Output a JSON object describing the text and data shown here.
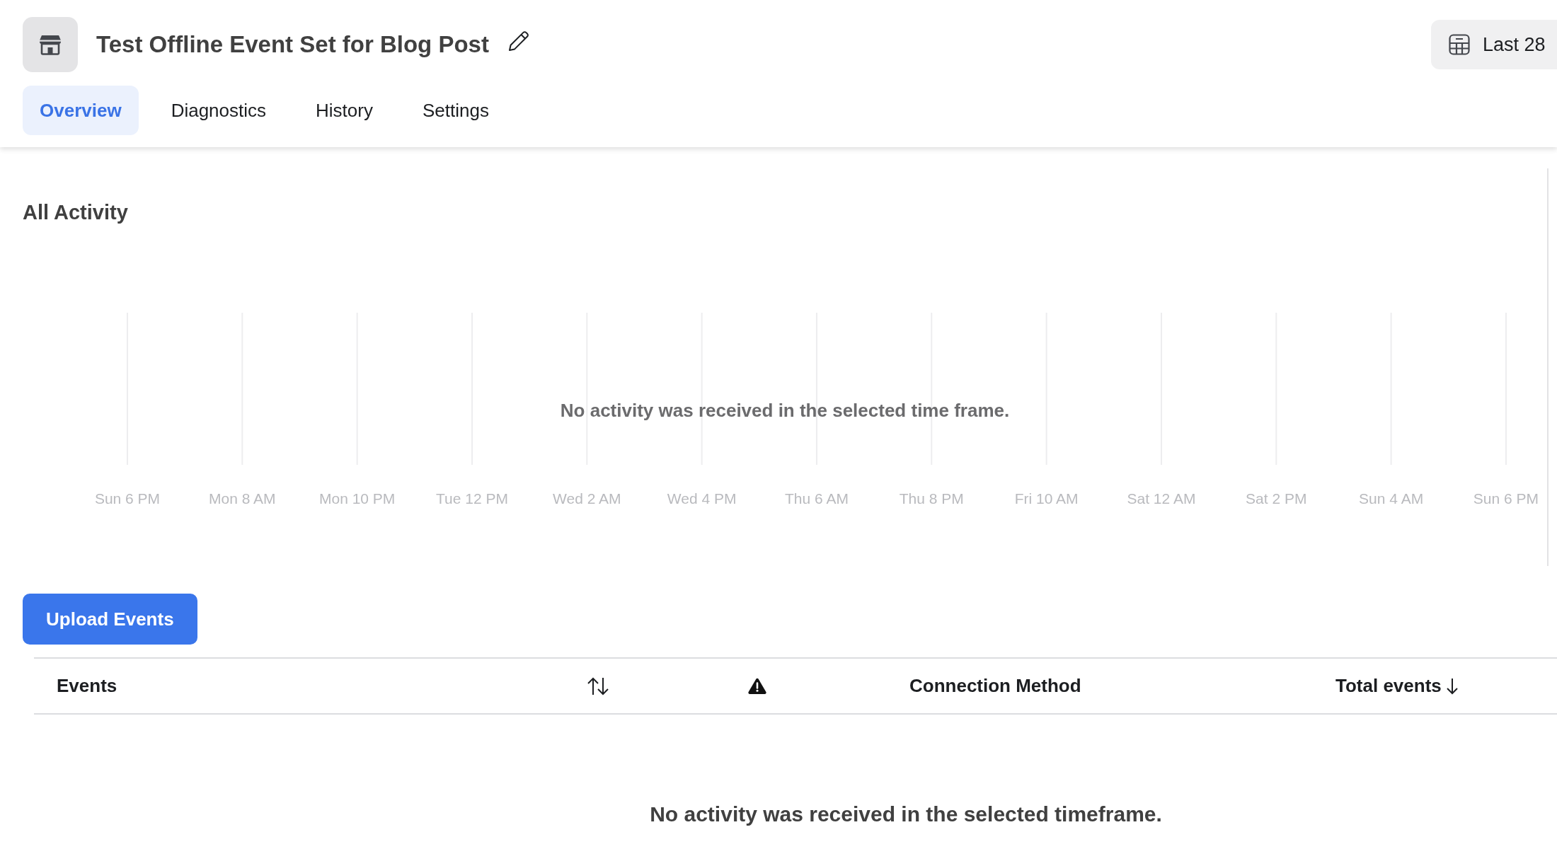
{
  "header": {
    "title": "Test Offline Event Set for Blog Post",
    "date_range": {
      "label": "Last 28"
    }
  },
  "tabs": [
    {
      "label": "Overview",
      "selected": true
    },
    {
      "label": "Diagnostics",
      "selected": false
    },
    {
      "label": "History",
      "selected": false
    },
    {
      "label": "Settings",
      "selected": false
    }
  ],
  "activity": {
    "title": "All Activity",
    "chart": {
      "x_axis_labels": [
        "Sun 6 PM",
        "Mon 8 AM",
        "Mon 10 PM",
        "Tue 12 PM",
        "Wed 2 AM",
        "Wed 4 PM",
        "Thu 6 AM",
        "Thu 8 PM",
        "Fri 10 AM",
        "Sat 12 AM",
        "Sat 2 PM",
        "Sun 4 AM",
        "Sun 6 PM"
      ]
    },
    "empty_message": "No activity was received in the selected time frame."
  },
  "upload_button": {
    "label": "Upload Events"
  },
  "table": {
    "columns": [
      {
        "kind": "text",
        "label": "Events"
      },
      {
        "kind": "sort"
      },
      {
        "kind": "alert"
      },
      {
        "kind": "text",
        "label": "Connection Method"
      },
      {
        "kind": "text",
        "label": "Total events",
        "sorted": true
      }
    ],
    "empty_message": "No activity was received in the selected timeframe."
  }
}
